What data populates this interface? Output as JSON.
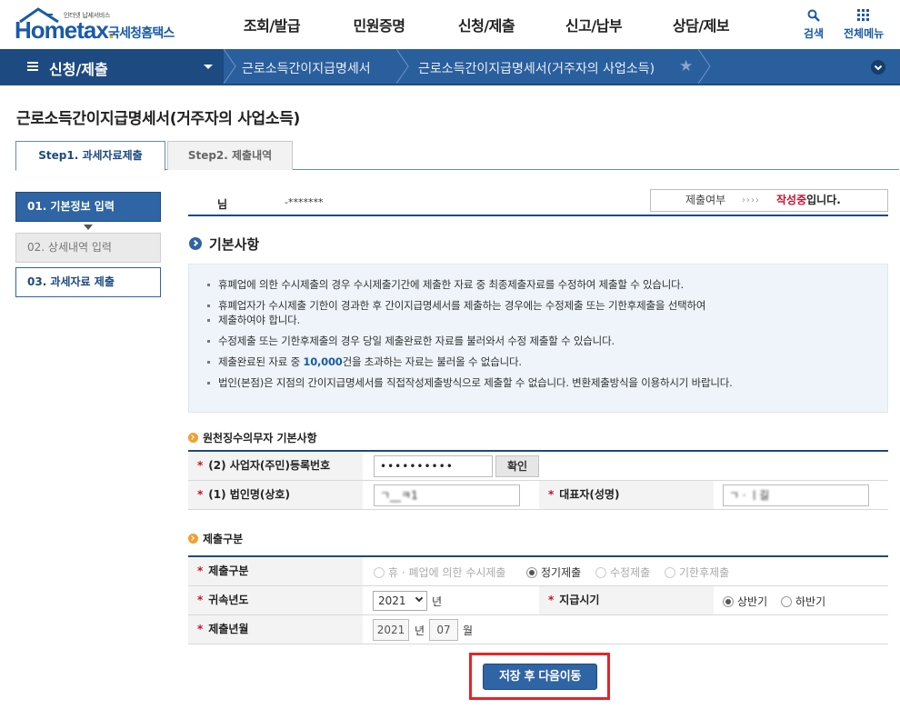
{
  "header": {
    "logo_tagline": "인터넷 납세서비스",
    "logo_main": "Hometax",
    "logo_dot": ".",
    "logo_kor": "국세청홈택스",
    "gnb": [
      "조회/발급",
      "민원증명",
      "신청/제출",
      "신고/납부",
      "상담/제보"
    ],
    "util_search": "검색",
    "util_menu": "전체메뉴"
  },
  "locbar": {
    "title": "신청/제출",
    "crumbs": [
      "근로소득간이지급명세서",
      "근로소득간이지급명세서(거주자의 사업소득)"
    ]
  },
  "page_title": "근로소득간이지급명세서(거주자의 사업소득)",
  "tabs": [
    "Step1. 과세자료제출",
    "Step2. 제출내역"
  ],
  "steps": [
    "01. 기본정보 입력",
    "02. 상세내역 입력",
    "03. 과세자료 제출"
  ],
  "info": {
    "name_label": "님",
    "name_value": "-*******",
    "status_label": "제출여부",
    "status_arrows": "››››",
    "status_value_red": "작성중",
    "status_value_rest": "입니다."
  },
  "section_title": "기본사항",
  "notice": {
    "items": [
      "휴폐업에 의한 수시제출의 경우 수시제출기간에 제출한 자료 중 최종제출자료를 수정하여 제출할 수 있습니다.",
      "휴폐업자가 수시제출 기한이 경과한 후 간이지급명세서를 제출하는 경우에는 수정제출 또는 기한후제출을 선택하여",
      "제출하여야 합니다.",
      "수정제출 또는 기한후제출의 경우 당일 제출완료한 자료를 불러와서 수정 제출할 수 있습니다.",
      "건을 초과하는 자료는 불러올 수 없습니다.",
      "법인(본점)은 지점의 간이지급명세서를 직접작성제출방식으로 제출할 수 없습니다. 변환제출방식을 이용하시기 바랍니다."
    ],
    "item5_prefix": "제출완료된 자료 중 ",
    "item5_bold": "10,000"
  },
  "withholder": {
    "heading": "원천징수의무자 기본사항",
    "brn_label": "(2) 사업자(주민)등록번호",
    "brn_value": "••••••••••",
    "confirm_btn": "확인",
    "corp_label": "(1) 법인명(상호)",
    "corp_value": "ㄱ__ㅋ1",
    "rep_label": "대표자(성명)",
    "rep_value": "ㄱㆍㅣ길"
  },
  "submission": {
    "heading": "제출구분",
    "type_label": "제출구분",
    "type_options": [
      "휴 · 폐업에 의한 수시제출",
      "정기제출",
      "수정제출",
      "기한후제출"
    ],
    "year_label": "귀속년도",
    "year_value": "2021",
    "year_unit": "년",
    "pay_label": "지급시기",
    "pay_options": [
      "상반기",
      "하반기"
    ],
    "month_label": "제출년월",
    "month_year": "2021",
    "month_year_unit": "년",
    "month_value": "07",
    "month_unit": "월"
  },
  "save_button": "저장 후 다음이동",
  "colors": {
    "primary": "#2f64a5",
    "navy": "#1d4a80",
    "accent_red": "#c8102e",
    "highlight": "#e5242b"
  }
}
